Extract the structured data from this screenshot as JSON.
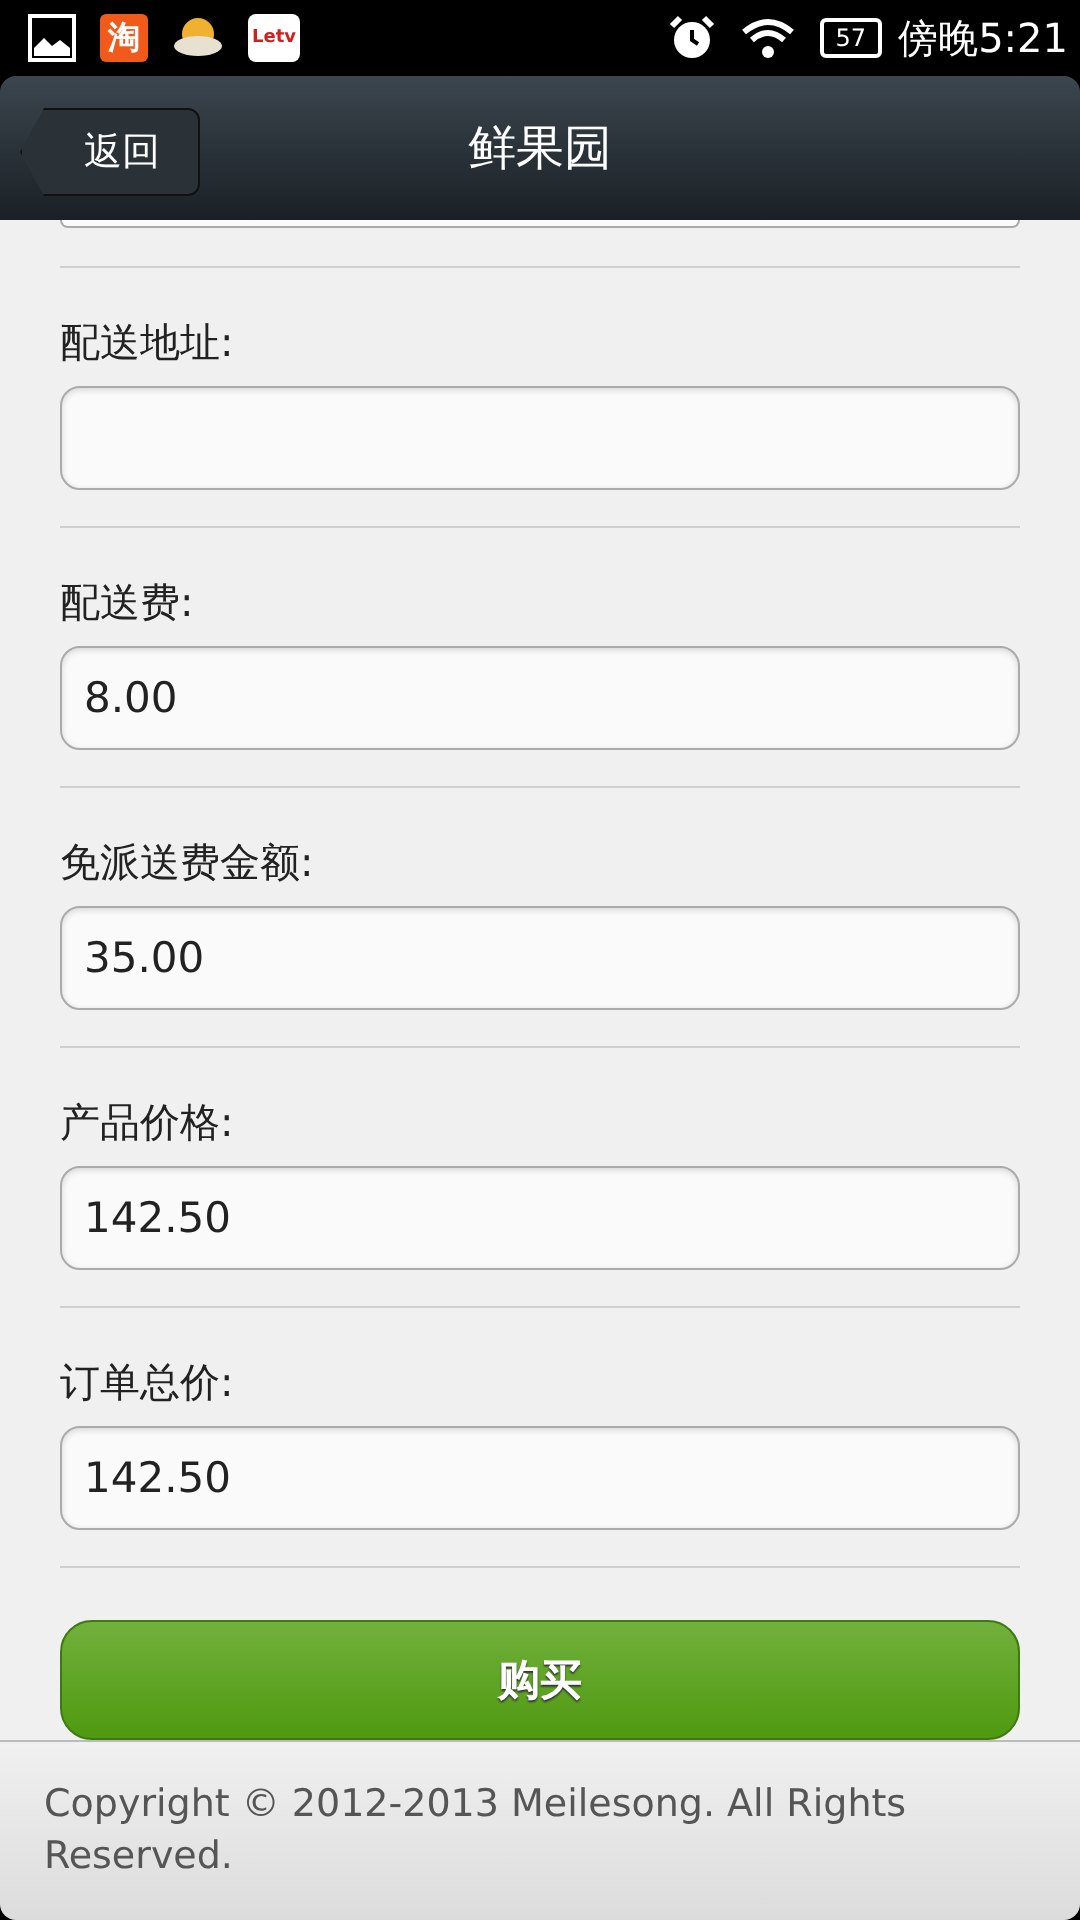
{
  "status_bar": {
    "apps": [
      {
        "kind": "gallery"
      },
      {
        "kind": "taobao",
        "text": "淘"
      },
      {
        "kind": "weather"
      },
      {
        "kind": "letv",
        "text": "Letv"
      }
    ],
    "battery": "57",
    "time": "傍晚5:21"
  },
  "header": {
    "back": "返回",
    "title": "鲜果园"
  },
  "fields": [
    {
      "label": "配送地址:"
    },
    {
      "label": "配送费:",
      "value": "8.00"
    },
    {
      "label": "免派送费金额:",
      "value": "35.00"
    },
    {
      "label": "产品价格:",
      "value": "142.50"
    },
    {
      "label": "订单总价:",
      "value": "142.50"
    }
  ],
  "buy_button": "购买",
  "footer": "Copyright © 2012-2013 Meilesong. All Rights Reserved."
}
